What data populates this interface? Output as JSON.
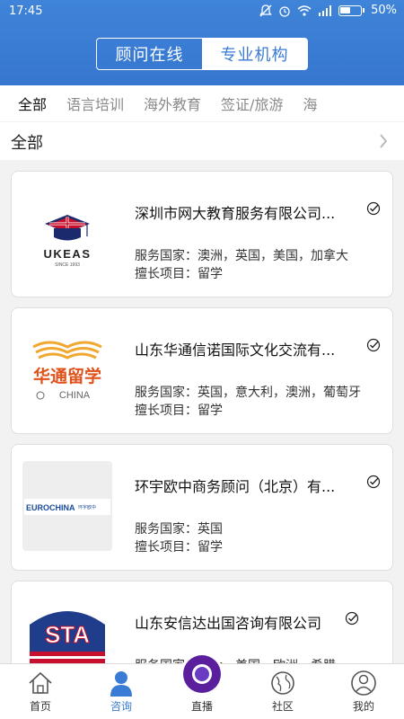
{
  "status_bar": {
    "time": "17:45",
    "battery": "50%"
  },
  "segmented": {
    "left": "顾问在线",
    "right": "专业机构"
  },
  "categories": [
    "全部",
    "语言培训",
    "海外教育",
    "签证/旅游",
    "海"
  ],
  "filter": {
    "label": "全部"
  },
  "colors": {
    "primary": "#3a7bd5",
    "verify": "#c9a227"
  },
  "agencies": [
    {
      "name": "深圳市网大教育服务有限公司...",
      "countries": "服务国家：澳洲，英国，美国，加拿大",
      "specialty": "擅长项目：留学",
      "logo": "ukeas-logo",
      "logo_text": "UKEAS",
      "logo_sub": "SINCE 1993"
    },
    {
      "name": "山东华通信诺国际文化交流有...",
      "countries": "服务国家：英国，意大利，澳洲，葡萄牙",
      "specialty": "擅长项目：留学",
      "logo": "huatong-logo",
      "logo_text": "华通留学",
      "logo_sub": "CHINA"
    },
    {
      "name": "环宇欧中商务顾问（北京）有...",
      "countries": "服务国家：英国",
      "specialty": "擅长项目：留学",
      "logo": "eurochina-logo",
      "logo_text": "EUROCHINA",
      "logo_sub": "环宇欧中"
    },
    {
      "name": "山东安信达出国咨询有限公司",
      "countries": "服务国家：意大，美国，欧洲，希腊",
      "specialty": "",
      "logo": "sta-logo",
      "logo_text": "STA",
      "logo_sub": ""
    }
  ],
  "nav": [
    {
      "label": "首页",
      "icon": "home-icon"
    },
    {
      "label": "咨询",
      "icon": "consult-icon"
    },
    {
      "label": "直播",
      "icon": "live-icon"
    },
    {
      "label": "社区",
      "icon": "globe-icon"
    },
    {
      "label": "我的",
      "icon": "profile-icon"
    }
  ]
}
